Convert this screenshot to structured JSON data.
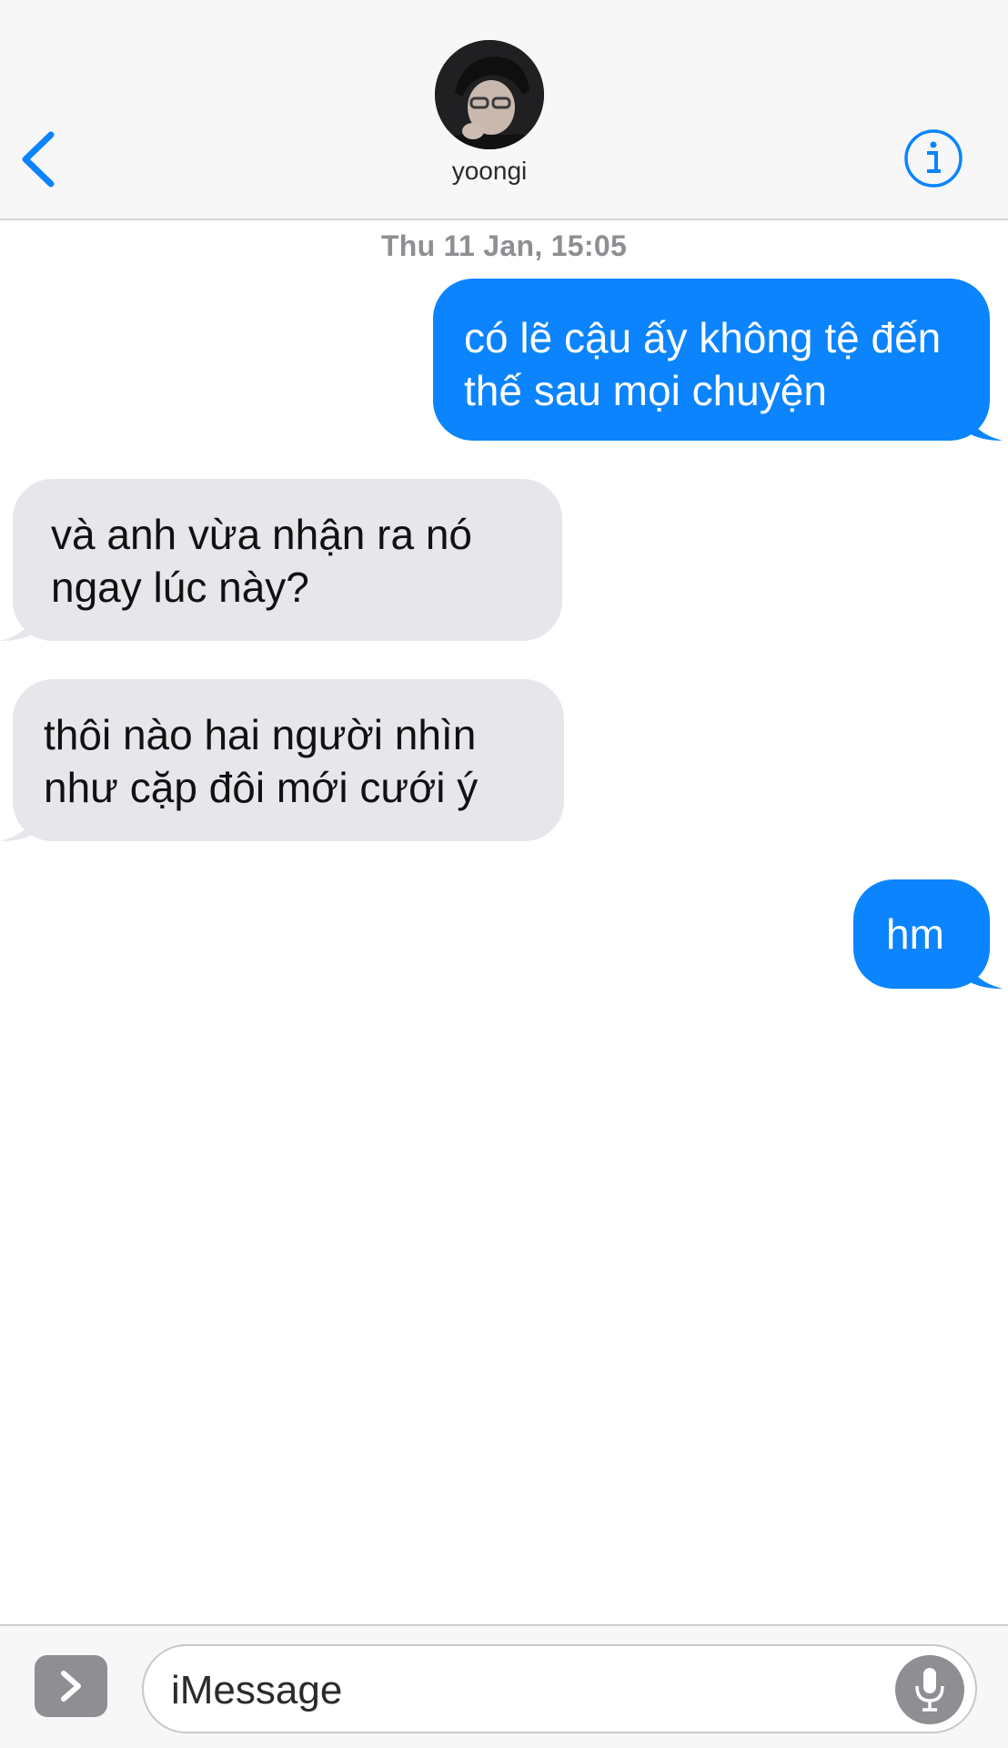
{
  "header": {
    "back_icon": "chevron-left-icon",
    "contact_name": "yoongi",
    "info_icon": "info-circle-icon",
    "accent_color": "#0b84fe"
  },
  "conversation": {
    "timestamp": "Thu 11 Jan, 15:05",
    "messages": [
      {
        "direction": "sent",
        "lines": [
          "có lẽ cậu ấy không tệ đến",
          "thế sau mọi chuyện"
        ]
      },
      {
        "direction": "received",
        "lines": [
          "và anh vừa nhận ra nó",
          "ngay lúc này?"
        ]
      },
      {
        "direction": "received",
        "lines": [
          "thôi nào hai người nhìn",
          "như cặp đôi mới cưới ý"
        ]
      },
      {
        "direction": "sent",
        "lines": [
          "hm"
        ]
      }
    ],
    "sent_color": "#0b84fe",
    "received_color": "#e6e6eb"
  },
  "input_bar": {
    "apps_icon": "chevron-right-icon",
    "placeholder": "iMessage",
    "value": "",
    "mic_icon": "microphone-icon"
  }
}
